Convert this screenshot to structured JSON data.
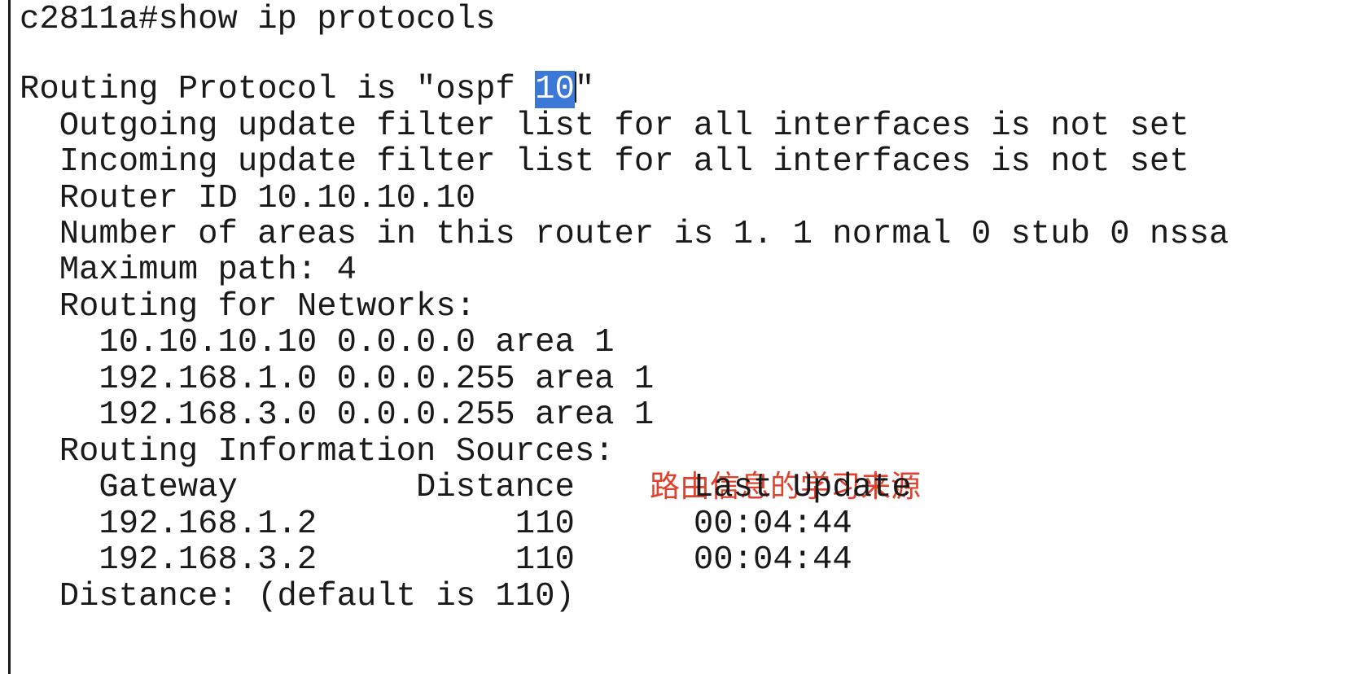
{
  "terminal": {
    "prompt_line": "c2811a#show ip protocols",
    "protocol_prefix": "Routing Protocol is \"ospf ",
    "protocol_highlight": "10",
    "protocol_suffix": "\"",
    "outgoing": "  Outgoing update filter list for all interfaces is not set",
    "incoming": "  Incoming update filter list for all interfaces is not set",
    "router_id": "  Router ID 10.10.10.10",
    "areas": "  Number of areas in this router is 1. 1 normal 0 stub 0 nssa",
    "max_path": "  Maximum path: 4",
    "routing_networks_header": "  Routing for Networks:",
    "networks": [
      "    10.10.10.10 0.0.0.0 area 1",
      "    192.168.1.0 0.0.0.255 area 1",
      "    192.168.3.0 0.0.0.255 area 1"
    ],
    "info_sources_header": "  Routing Information Sources:",
    "sources_table_header": "    Gateway         Distance      Last Update",
    "sources_rows": [
      "    192.168.1.2          110      00:04:44",
      "    192.168.3.2          110      00:04:44"
    ],
    "distance_line": "  Distance: (default is 110)"
  },
  "annotation": {
    "text": "路由信息的学习来源",
    "color": "#e0402c"
  },
  "colors": {
    "text": "#1a1a1a",
    "selection": "#3c78d8",
    "background": "#ffffff"
  }
}
